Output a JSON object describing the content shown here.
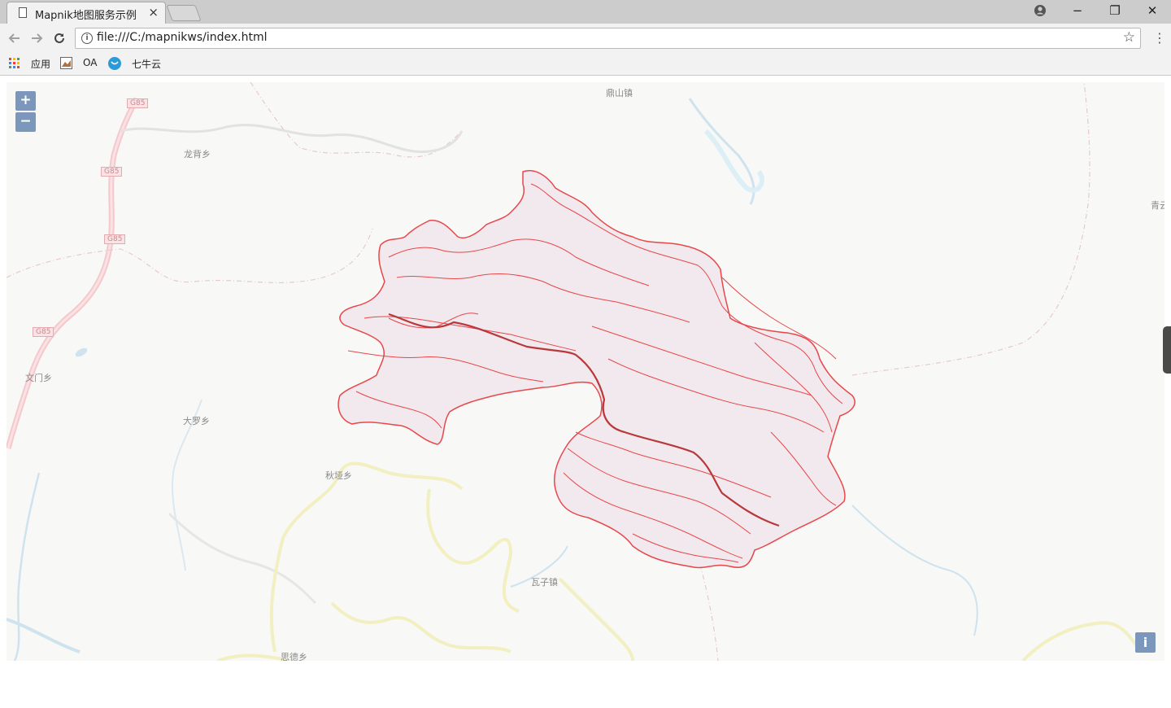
{
  "browser": {
    "tab_title": "Mapnik地图服务示例",
    "tab_close": "×",
    "url": "file:///C:/mapnikws/index.html",
    "info_glyph": "i",
    "bookmarks": {
      "apps": "应用",
      "oa": "OA",
      "qiniu": "七牛云"
    },
    "window": {
      "minimize": "−",
      "restore": "❐",
      "close": "✕"
    }
  },
  "map": {
    "zoom_in": "+",
    "zoom_out": "−",
    "info_button": "i",
    "places": {
      "dingshan": "鼎山镇",
      "longbei": "龙背乡",
      "qing": "青云",
      "wenmen": "文门乡",
      "daluo": "大罗乡",
      "qiuya": "秋垭乡",
      "wazi": "瓦子镇",
      "side": "思德乡"
    },
    "road_shields": [
      "G85",
      "G85",
      "G85",
      "G85"
    ],
    "overlay_color": "#e8474a",
    "overlay_fill": "#f1e9ee"
  }
}
